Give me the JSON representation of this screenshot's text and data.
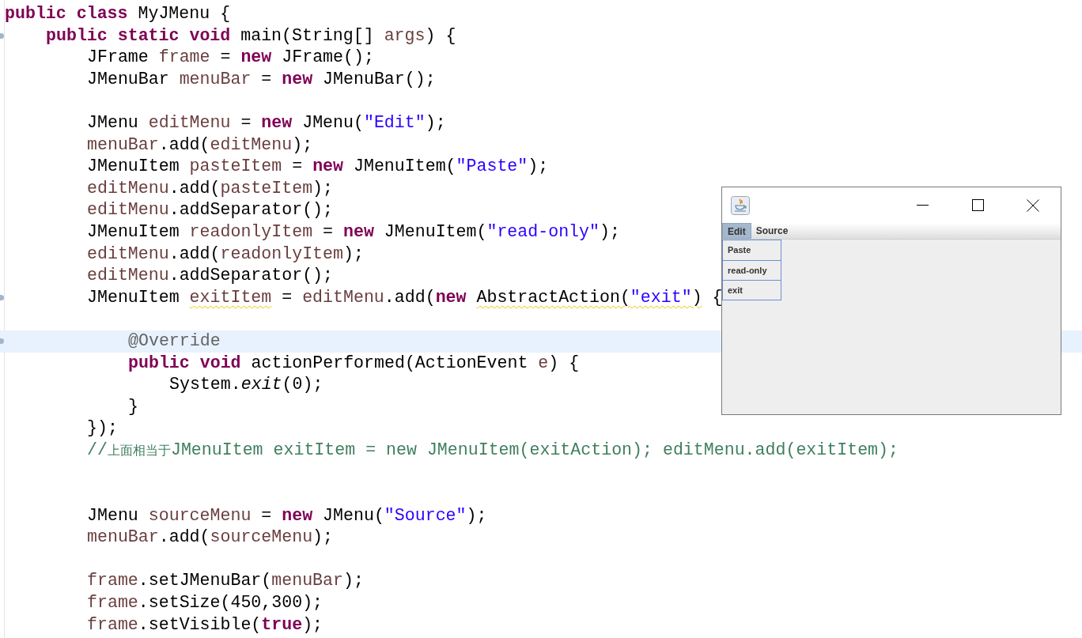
{
  "editor": {
    "lines": [
      {
        "marker": false,
        "current": false,
        "tokens": [
          {
            "kind": "keyword",
            "text": "public class",
            "warning": false
          },
          {
            "kind": "plain",
            "text": " MyJMenu {",
            "warning": false
          }
        ],
        "children": [
          {
            "marker": true,
            "current": false,
            "tokens": [
              {
                "kind": "keyword",
                "text": "public static void",
                "warning": false
              },
              {
                "kind": "plain",
                "text": " main(String[] ",
                "warning": false
              },
              {
                "kind": "variable",
                "text": "args",
                "warning": false
              },
              {
                "kind": "plain",
                "text": ") {",
                "warning": false
              }
            ],
            "children": [
              {
                "marker": false,
                "current": false,
                "tokens": [
                  {
                    "kind": "plain",
                    "text": "JFrame ",
                    "warning": false
                  },
                  {
                    "kind": "variable",
                    "text": "frame",
                    "warning": false
                  },
                  {
                    "kind": "plain",
                    "text": " = ",
                    "warning": false
                  },
                  {
                    "kind": "keyword",
                    "text": "new",
                    "warning": false
                  },
                  {
                    "kind": "plain",
                    "text": " JFrame();",
                    "warning": false
                  }
                ]
              },
              {
                "marker": false,
                "current": false,
                "tokens": [
                  {
                    "kind": "plain",
                    "text": "JMenuBar ",
                    "warning": false
                  },
                  {
                    "kind": "variable",
                    "text": "menuBar",
                    "warning": false
                  },
                  {
                    "kind": "plain",
                    "text": " = ",
                    "warning": false
                  },
                  {
                    "kind": "keyword",
                    "text": "new",
                    "warning": false
                  },
                  {
                    "kind": "plain",
                    "text": " JMenuBar();",
                    "warning": false
                  }
                ]
              },
              {
                "marker": false,
                "current": false
              },
              {
                "marker": false,
                "current": false,
                "tokens": [
                  {
                    "kind": "plain",
                    "text": "JMenu ",
                    "warning": false
                  },
                  {
                    "kind": "variable",
                    "text": "editMenu",
                    "warning": false
                  },
                  {
                    "kind": "plain",
                    "text": " = ",
                    "warning": false
                  },
                  {
                    "kind": "keyword",
                    "text": "new",
                    "warning": false
                  },
                  {
                    "kind": "plain",
                    "text": " JMenu(",
                    "warning": false
                  },
                  {
                    "kind": "string",
                    "text": "\"Edit\"",
                    "warning": false
                  },
                  {
                    "kind": "plain",
                    "text": ");",
                    "warning": false
                  }
                ]
              },
              {
                "marker": false,
                "current": false,
                "tokens": [
                  {
                    "kind": "variable",
                    "text": "menuBar",
                    "warning": false
                  },
                  {
                    "kind": "plain",
                    "text": ".add(",
                    "warning": false
                  },
                  {
                    "kind": "variable",
                    "text": "editMenu",
                    "warning": false
                  },
                  {
                    "kind": "plain",
                    "text": ");",
                    "warning": false
                  }
                ]
              },
              {
                "marker": false,
                "current": false,
                "tokens": [
                  {
                    "kind": "plain",
                    "text": "JMenuItem ",
                    "warning": false
                  },
                  {
                    "kind": "variable",
                    "text": "pasteItem",
                    "warning": false
                  },
                  {
                    "kind": "plain",
                    "text": " = ",
                    "warning": false
                  },
                  {
                    "kind": "keyword",
                    "text": "new",
                    "warning": false
                  },
                  {
                    "kind": "plain",
                    "text": " JMenuItem(",
                    "warning": false
                  },
                  {
                    "kind": "string",
                    "text": "\"Paste\"",
                    "warning": false
                  },
                  {
                    "kind": "plain",
                    "text": ");",
                    "warning": false
                  }
                ]
              },
              {
                "marker": false,
                "current": false,
                "tokens": [
                  {
                    "kind": "variable",
                    "text": "editMenu",
                    "warning": false
                  },
                  {
                    "kind": "plain",
                    "text": ".add(",
                    "warning": false
                  },
                  {
                    "kind": "variable",
                    "text": "pasteItem",
                    "warning": false
                  },
                  {
                    "kind": "plain",
                    "text": ");",
                    "warning": false
                  }
                ]
              },
              {
                "marker": false,
                "current": false,
                "tokens": [
                  {
                    "kind": "variable",
                    "text": "editMenu",
                    "warning": false
                  },
                  {
                    "kind": "plain",
                    "text": ".addSeparator();",
                    "warning": false
                  }
                ]
              },
              {
                "marker": false,
                "current": false,
                "tokens": [
                  {
                    "kind": "plain",
                    "text": "JMenuItem ",
                    "warning": false
                  },
                  {
                    "kind": "variable",
                    "text": "readonlyItem",
                    "warning": false
                  },
                  {
                    "kind": "plain",
                    "text": " = ",
                    "warning": false
                  },
                  {
                    "kind": "keyword",
                    "text": "new",
                    "warning": false
                  },
                  {
                    "kind": "plain",
                    "text": " JMenuItem(",
                    "warning": false
                  },
                  {
                    "kind": "string",
                    "text": "\"read-only\"",
                    "warning": false
                  },
                  {
                    "kind": "plain",
                    "text": ");",
                    "warning": false
                  }
                ]
              },
              {
                "marker": false,
                "current": false,
                "tokens": [
                  {
                    "kind": "variable",
                    "text": "editMenu",
                    "warning": false
                  },
                  {
                    "kind": "plain",
                    "text": ".add(",
                    "warning": false
                  },
                  {
                    "kind": "variable",
                    "text": "readonlyItem",
                    "warning": false
                  },
                  {
                    "kind": "plain",
                    "text": ");",
                    "warning": false
                  }
                ]
              },
              {
                "marker": false,
                "current": false,
                "tokens": [
                  {
                    "kind": "variable",
                    "text": "editMenu",
                    "warning": false
                  },
                  {
                    "kind": "plain",
                    "text": ".addSeparator();",
                    "warning": false
                  }
                ]
              },
              {
                "marker": true,
                "current": false,
                "tokens": [
                  {
                    "kind": "plain",
                    "text": "JMenuItem ",
                    "warning": false
                  },
                  {
                    "kind": "variable",
                    "text": "exitItem",
                    "warning": true
                  },
                  {
                    "kind": "plain",
                    "text": " = ",
                    "warning": false
                  },
                  {
                    "kind": "variable",
                    "text": "editMenu",
                    "warning": false
                  },
                  {
                    "kind": "plain",
                    "text": ".add(",
                    "warning": false
                  },
                  {
                    "kind": "keyword",
                    "text": "new ",
                    "warning": false
                  },
                  {
                    "kind": "plain",
                    "text": "AbstractAction(",
                    "warning": true
                  },
                  {
                    "kind": "string",
                    "text": "\"exit\"",
                    "warning": true
                  },
                  {
                    "kind": "plain",
                    "text": ")",
                    "warning": true
                  },
                  {
                    "kind": "plain",
                    "text": " {",
                    "warning": false
                  }
                ],
                "children": [
                  {
                    "marker": false,
                    "current": false
                  },
                  {
                    "marker": true,
                    "current": true,
                    "tokens": [
                      {
                        "kind": "annotation",
                        "text": "@Override",
                        "warning": false
                      }
                    ]
                  },
                  {
                    "marker": false,
                    "current": false,
                    "tokens": [
                      {
                        "kind": "keyword",
                        "text": "public void",
                        "warning": false
                      },
                      {
                        "kind": "plain",
                        "text": " actionPerformed(ActionEvent ",
                        "warning": false
                      },
                      {
                        "kind": "variable",
                        "text": "e",
                        "warning": false
                      },
                      {
                        "kind": "plain",
                        "text": ") {",
                        "warning": false
                      }
                    ],
                    "children": [
                      {
                        "marker": false,
                        "current": false,
                        "tokens": [
                          {
                            "kind": "plain",
                            "text": "System.",
                            "warning": false
                          },
                          {
                            "kind": "static",
                            "text": "exit",
                            "warning": false
                          },
                          {
                            "kind": "plain",
                            "text": "(0);",
                            "warning": false
                          }
                        ]
                      }
                    ]
                  },
                  {
                    "marker": false,
                    "current": false,
                    "tokens": [
                      {
                        "kind": "plain",
                        "text": "}",
                        "warning": false
                      }
                    ]
                  }
                ]
              },
              {
                "marker": false,
                "current": false,
                "tokens": [
                  {
                    "kind": "plain",
                    "text": "});",
                    "warning": false
                  }
                ]
              },
              {
                "marker": false,
                "current": false,
                "tokens": [
                  {
                    "kind": "comment",
                    "text": "//",
                    "warning": false
                  },
                  {
                    "kind": "comment_cjk",
                    "text": "上面相当于",
                    "warning": false
                  },
                  {
                    "kind": "comment",
                    "text": "JMenuItem exitItem = new JMenuItem(exitAction); editMenu.add(exitItem);",
                    "warning": false
                  }
                ]
              },
              {
                "marker": false,
                "current": false
              },
              {
                "marker": false,
                "current": false
              },
              {
                "marker": false,
                "current": false,
                "tokens": [
                  {
                    "kind": "plain",
                    "text": "JMenu ",
                    "warning": false
                  },
                  {
                    "kind": "variable",
                    "text": "sourceMenu",
                    "warning": false
                  },
                  {
                    "kind": "plain",
                    "text": " = ",
                    "warning": false
                  },
                  {
                    "kind": "keyword",
                    "text": "new",
                    "warning": false
                  },
                  {
                    "kind": "plain",
                    "text": " JMenu(",
                    "warning": false
                  },
                  {
                    "kind": "string",
                    "text": "\"Source\"",
                    "warning": false
                  },
                  {
                    "kind": "plain",
                    "text": ");",
                    "warning": false
                  }
                ]
              },
              {
                "marker": false,
                "current": false,
                "tokens": [
                  {
                    "kind": "variable",
                    "text": "menuBar",
                    "warning": false
                  },
                  {
                    "kind": "plain",
                    "text": ".add(",
                    "warning": false
                  },
                  {
                    "kind": "variable",
                    "text": "sourceMenu",
                    "warning": false
                  },
                  {
                    "kind": "plain",
                    "text": ");",
                    "warning": false
                  }
                ]
              },
              {
                "marker": false,
                "current": false
              },
              {
                "marker": false,
                "current": false,
                "tokens": [
                  {
                    "kind": "variable",
                    "text": "frame",
                    "warning": false
                  },
                  {
                    "kind": "plain",
                    "text": ".setJMenuBar(",
                    "warning": false
                  },
                  {
                    "kind": "variable",
                    "text": "menuBar",
                    "warning": false
                  },
                  {
                    "kind": "plain",
                    "text": ");",
                    "warning": false
                  }
                ]
              },
              {
                "marker": false,
                "current": false,
                "tokens": [
                  {
                    "kind": "variable",
                    "text": "frame",
                    "warning": false
                  },
                  {
                    "kind": "plain",
                    "text": ".setSize(450,300);",
                    "warning": false
                  }
                ]
              },
              {
                "marker": false,
                "current": false,
                "tokens": [
                  {
                    "kind": "variable",
                    "text": "frame",
                    "warning": false
                  },
                  {
                    "kind": "plain",
                    "text": ".setVisible(",
                    "warning": false
                  },
                  {
                    "kind": "keyword",
                    "text": "true",
                    "warning": false
                  },
                  {
                    "kind": "plain",
                    "text": ");",
                    "warning": false
                  }
                ]
              }
            ]
          }
        ]
      }
    ]
  },
  "java_window": {
    "menus": [
      {
        "label": "Edit",
        "selected": true
      },
      {
        "label": "Source",
        "selected": false
      }
    ],
    "dropdown": {
      "items": [
        "Paste",
        "read-only",
        "exit"
      ]
    }
  }
}
